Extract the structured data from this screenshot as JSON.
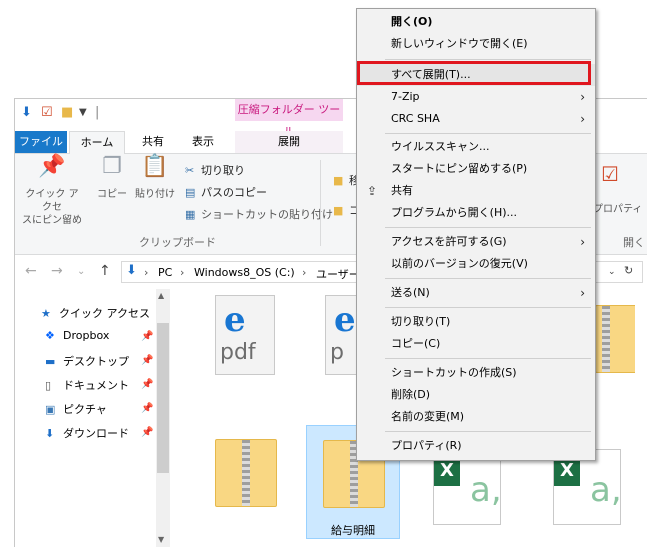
{
  "ribbon": {
    "tool_header": "圧縮フォルダー ツール",
    "tabs": [
      "ファイル",
      "ホーム",
      "共有",
      "表示",
      "展開"
    ],
    "pin_quick_access": "クイック アクセ\nスにピン留め",
    "copy": "コピー",
    "paste": "貼り付け",
    "cut": "切り取り",
    "copy_path": "パスのコピー",
    "paste_shortcut": "ショートカットの貼り付け",
    "group_clipboard": "クリップボード",
    "move_partial": "移",
    "copy_partial": "コ",
    "properties_partial": "プロパティ",
    "open_partial": "開く"
  },
  "address": {
    "segments": [
      "PC",
      "Windows8_OS (C:)",
      "ユーザー"
    ],
    "separators": [
      "›",
      "›",
      "›"
    ]
  },
  "navpane": {
    "items": [
      {
        "label": "クイック アクセス",
        "icon": "star-icon"
      },
      {
        "label": "Dropbox",
        "icon": "dropbox-icon"
      },
      {
        "label": "デスクトップ",
        "icon": "desktop-icon"
      },
      {
        "label": "ドキュメント",
        "icon": "document-icon"
      },
      {
        "label": "ピクチャ",
        "icon": "picture-icon"
      },
      {
        "label": "ダウンロード",
        "icon": "download-icon"
      }
    ]
  },
  "files": {
    "pdf_text": "pdf",
    "pdf_text_partial": "p",
    "selected_label": "給与明細",
    "excel_x": "X",
    "excel_a": "a,"
  },
  "context_menu": {
    "items": [
      {
        "label": "開く(O)",
        "bold": true
      },
      {
        "label": "新しいウィンドウで開く(E)"
      },
      {
        "label": "すべて展開(T)..."
      },
      {
        "label": "7-Zip",
        "submenu": true
      },
      {
        "label": "CRC SHA",
        "submenu": true
      },
      {
        "label": "ウイルススキャン..."
      },
      {
        "label": "スタートにピン留めする(P)"
      },
      {
        "label": "共有",
        "icon": "share-icon"
      },
      {
        "label": "プログラムから開く(H)..."
      },
      {
        "label": "アクセスを許可する(G)",
        "submenu": true
      },
      {
        "label": "以前のバージョンの復元(V)"
      },
      {
        "label": "送る(N)",
        "submenu": true
      },
      {
        "label": "切り取り(T)"
      },
      {
        "label": "コピー(C)"
      },
      {
        "label": "ショートカットの作成(S)"
      },
      {
        "label": "削除(D)"
      },
      {
        "label": "名前の変更(M)"
      },
      {
        "label": "プロパティ(R)"
      }
    ]
  },
  "colors": {
    "highlight_box": "#e0161e",
    "file_tab": "#1979ca",
    "tool_header_text": "#c9187e",
    "selection": "#cce8ff"
  }
}
